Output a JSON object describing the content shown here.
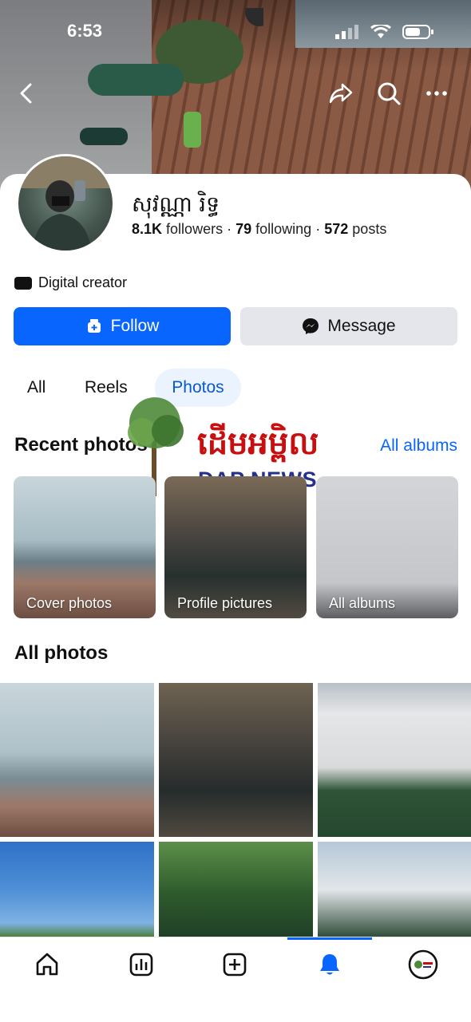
{
  "status_bar": {
    "time": "6:53"
  },
  "profile": {
    "name": "សុវណ្ណា រិទ្ធ",
    "followers_count": "8.1K",
    "followers_label": "followers",
    "following_count": "79",
    "following_label": "following",
    "posts_count": "572",
    "posts_label": "posts",
    "separator": "·",
    "category": "Digital creator"
  },
  "actions": {
    "follow_label": "Follow",
    "message_label": "Message"
  },
  "tabs": [
    {
      "label": "All",
      "selected": false
    },
    {
      "label": "Reels",
      "selected": false
    },
    {
      "label": "Photos",
      "selected": true
    }
  ],
  "recent": {
    "title": "Recent photos",
    "all_albums_link": "All albums",
    "albums": [
      {
        "label": "Cover photos"
      },
      {
        "label": "Profile pictures"
      },
      {
        "label": "All albums"
      }
    ]
  },
  "watermark": {
    "khmer": "ដើមអម្ពិល",
    "latin": "DAP NEWS"
  },
  "all_photos": {
    "title": "All photos"
  },
  "bottom_nav": [
    {
      "name": "home-icon"
    },
    {
      "name": "dashboard-icon"
    },
    {
      "name": "create-icon"
    },
    {
      "name": "notifications-icon",
      "active": true
    },
    {
      "name": "profile-avatar-icon"
    }
  ],
  "colors": {
    "accent": "#0866ff",
    "tab_selected_bg": "#ebf3ff",
    "message_bg": "#e4e6eb"
  }
}
